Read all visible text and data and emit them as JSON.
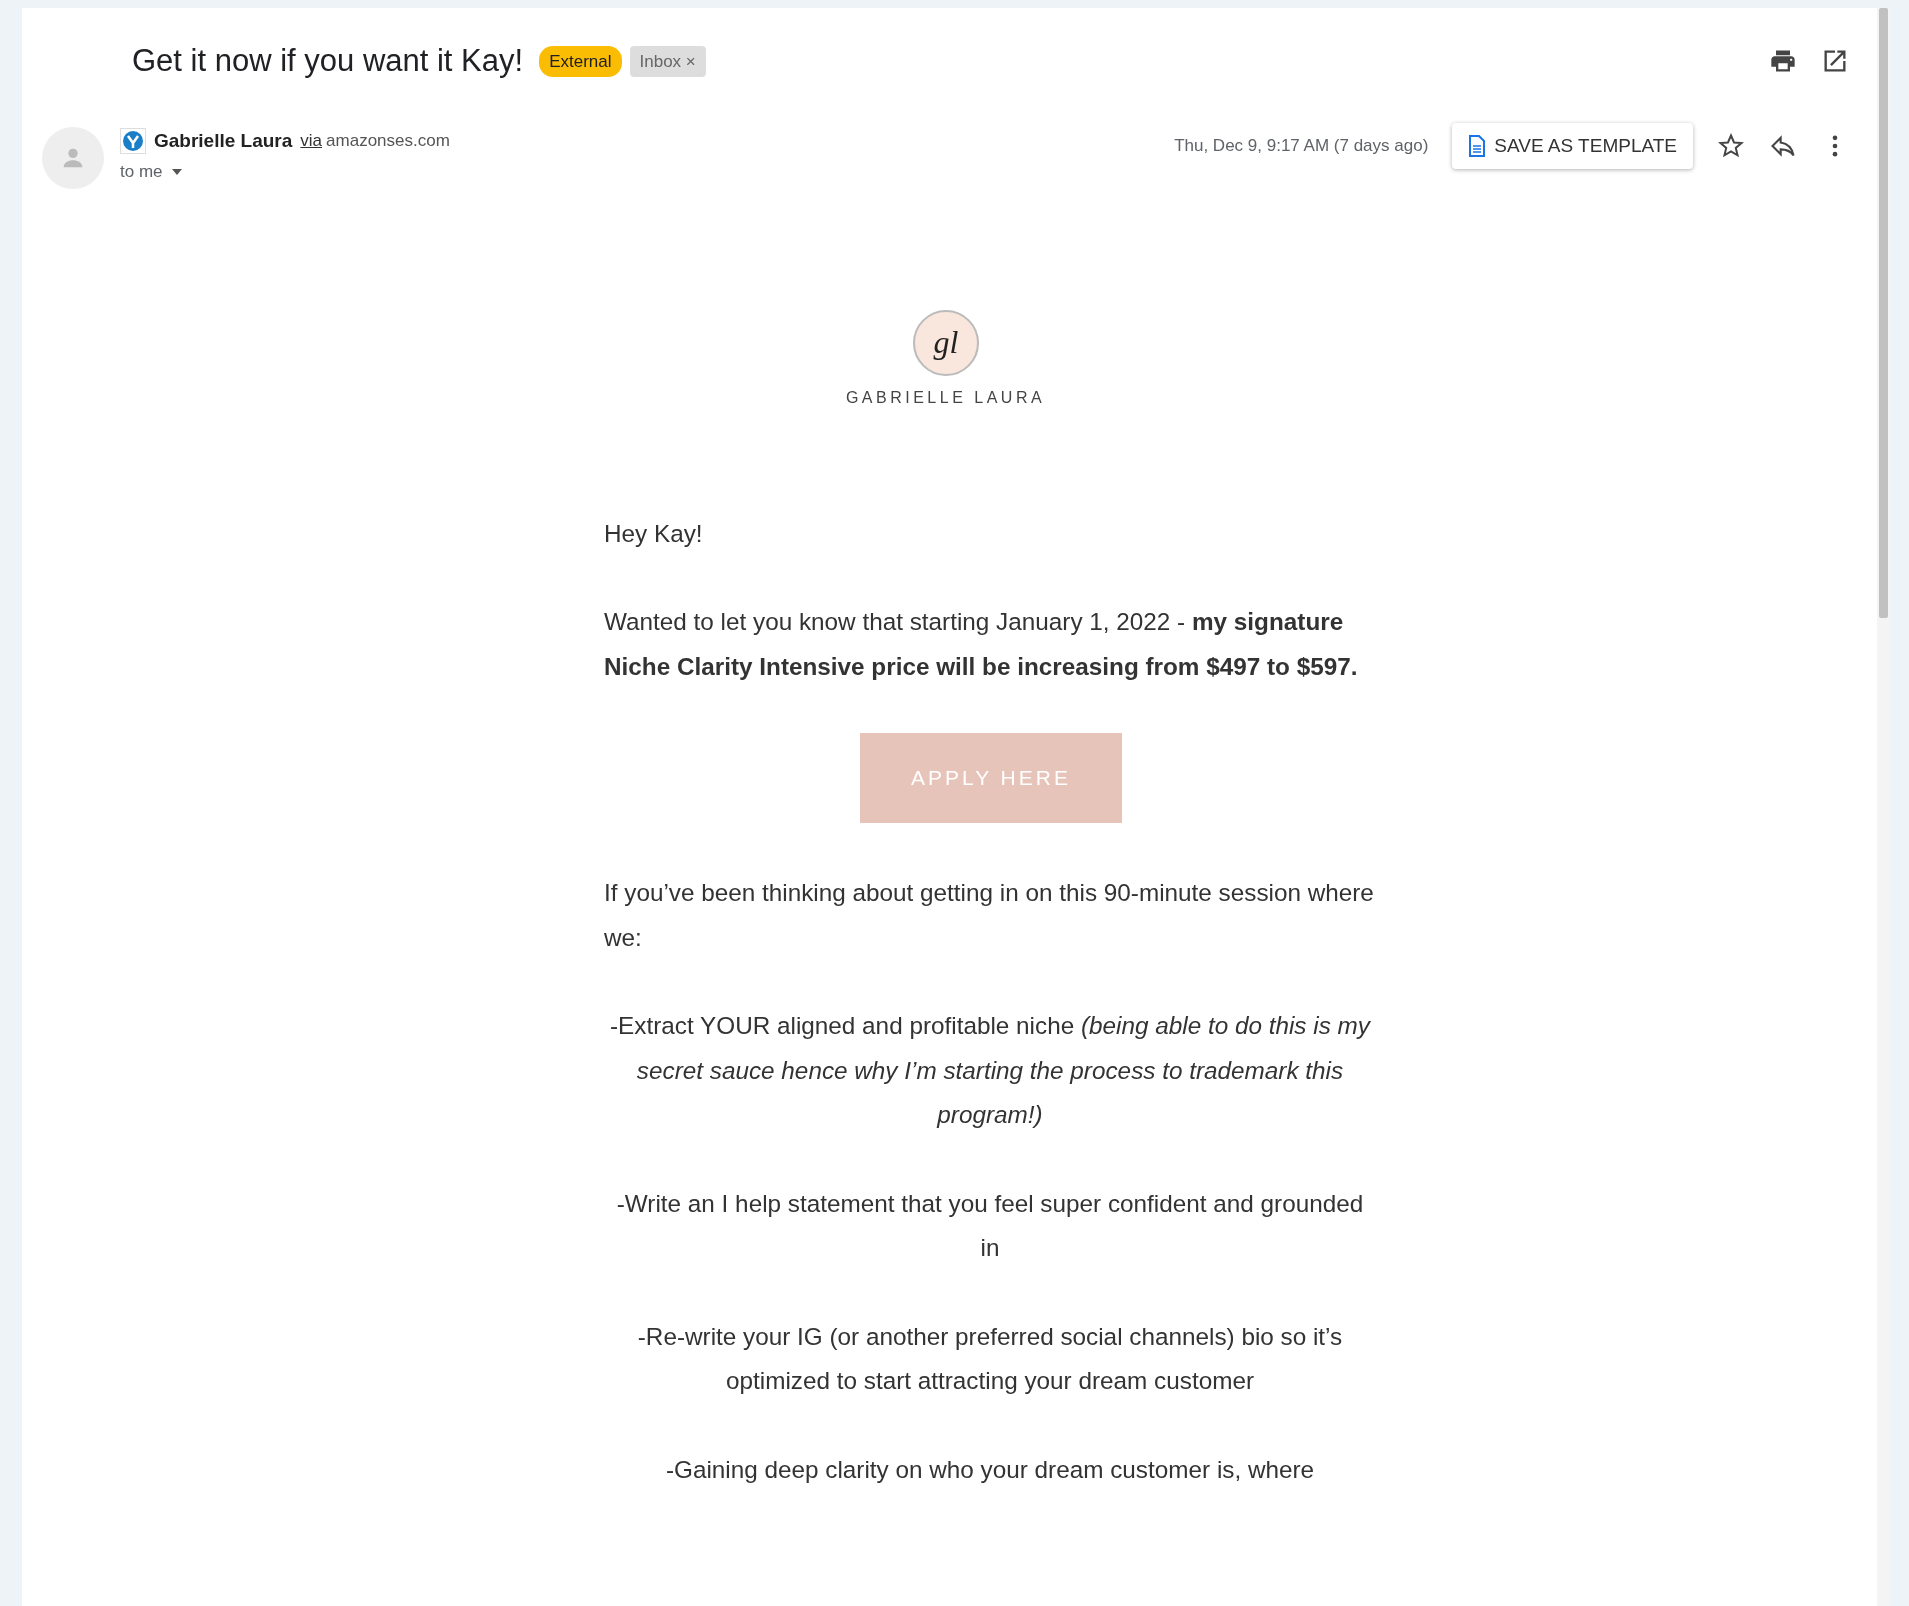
{
  "subject": "Get it now if you want it Kay!",
  "labels": [
    {
      "kind": "external",
      "text": "External"
    },
    {
      "kind": "inbox",
      "text": "Inbox",
      "close": "×"
    }
  ],
  "sender": {
    "name": "Gabrielle Laura",
    "via": "via",
    "domain": "amazonses.com",
    "recipient": "to me"
  },
  "date": "Thu, Dec 9, 9:17 AM (7 days ago)",
  "save_template": "SAVE AS TEMPLATE",
  "logo": {
    "monogram": "gl",
    "name": "GABRIELLE LAURA"
  },
  "body": [
    {
      "kind": "left-paragraph",
      "text": "Hey Kay!"
    },
    {
      "kind": "left-paragraph",
      "text": "Wanted to let you know that starting January 1, 2022 - **my signature Niche Clarity Intensive price will be increasing from $497 to $597.**"
    },
    {
      "kind": "cta",
      "text": "APPLY HERE"
    },
    {
      "kind": "left-paragraph",
      "text": "If you’ve been thinking about getting in on this 90-minute session where we:"
    },
    {
      "kind": "center-paragraph",
      "text": "-Extract YOUR aligned and profitable niche *(being able to do this is my secret sauce hence why I’m starting the process to trademark this program!)*"
    },
    {
      "kind": "center-paragraph",
      "text": "-Write an I help statement that you feel super confident and grounded in"
    },
    {
      "kind": "center-paragraph",
      "text": "-Re-write your IG (or another preferred social channels) bio so it’s optimized to start attracting your dream customer"
    },
    {
      "kind": "center-paragraph",
      "text": "-Gaining deep clarity on who your dream customer is, where"
    }
  ]
}
